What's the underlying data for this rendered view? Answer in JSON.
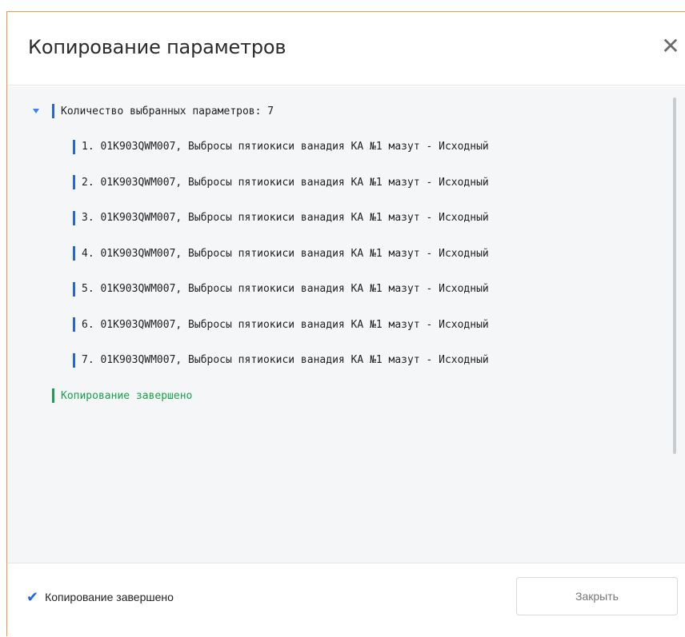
{
  "dialog": {
    "title": "Копирование параметров",
    "close_icon": "close-icon"
  },
  "tree": {
    "root_label": "Количество выбранных параметров: 7",
    "items": [
      "1. 01K903QWM007, Выбросы пятиокиси ванадия КА №1 мазут - Исходный",
      "2. 01K903QWM007, Выбросы пятиокиси ванадия КА №1 мазут - Исходный",
      "3. 01K903QWM007, Выбросы пятиокиси ванадия КА №1 мазут - Исходный",
      "4. 01K903QWM007, Выбросы пятиокиси ванадия КА №1 мазут - Исходный",
      "5. 01K903QWM007, Выбросы пятиокиси ванадия КА №1 мазут - Исходный",
      "6. 01K903QWM007, Выбросы пятиокиси ванадия КА №1 мазут - Исходный",
      "7. 01K903QWM007, Выбросы пятиокиси ванадия КА №1 мазут - Исходный"
    ],
    "done_label": "Копирование завершено"
  },
  "footer": {
    "status_text": "Копирование завершено",
    "status_icon": "check-icon",
    "close_button_label": "Закрыть"
  },
  "colors": {
    "accent": "#2563eb",
    "success": "#16a34a",
    "dialog_border": "#e89a3c"
  }
}
